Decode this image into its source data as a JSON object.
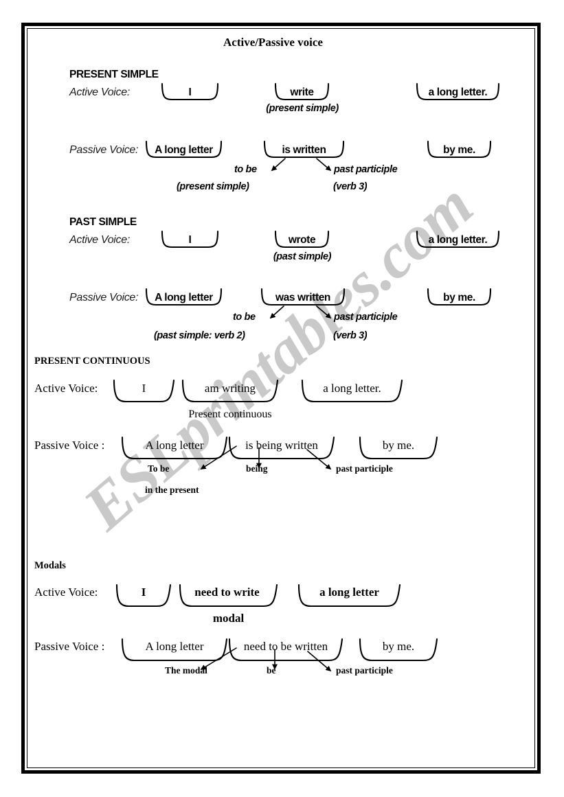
{
  "document": {
    "title": "Active/Passive voice",
    "watermark": "ESLprintables.com"
  },
  "sections": [
    {
      "id": "present-simple",
      "heading": "PRESENT SIMPLE",
      "style": "sans",
      "active": {
        "label": "Active Voice:",
        "cells": [
          "I",
          "write",
          "a long letter."
        ],
        "note": "(present simple)"
      },
      "passive": {
        "label": "Passive Voice:",
        "cells": [
          "A long letter",
          "is written",
          "by me."
        ],
        "annotations": [
          "to be",
          "past participle"
        ],
        "notes": [
          "(present simple)",
          "(verb 3)"
        ]
      }
    },
    {
      "id": "past-simple",
      "heading": "PAST SIMPLE",
      "style": "sans",
      "active": {
        "label": "Active Voice:",
        "cells": [
          "I",
          "wrote",
          "a long letter."
        ],
        "note": "(past simple)"
      },
      "passive": {
        "label": "Passive Voice:",
        "cells": [
          "A long letter",
          "was written",
          "by me."
        ],
        "annotations": [
          "to be",
          "past participle"
        ],
        "notes": [
          "(past simple: verb 2)",
          "(verb 3)"
        ]
      }
    },
    {
      "id": "present-continuous",
      "heading": "PRESENT CONTINUOUS",
      "style": "serif",
      "active": {
        "label": "Active Voice:",
        "cells": [
          "I",
          "am writing",
          "a long letter."
        ],
        "note": "Present continuous"
      },
      "passive": {
        "label": "Passive Voice :",
        "cells": [
          "A long letter",
          "is being written",
          "by me."
        ],
        "annotations": [
          "To be",
          "being",
          "past participle"
        ],
        "notes": [
          "in the present"
        ]
      }
    },
    {
      "id": "modals",
      "heading": "Modals",
      "style": "serif",
      "active": {
        "label": "Active Voice:",
        "cells": [
          "I",
          "need to write",
          "a long letter"
        ],
        "note": "modal"
      },
      "passive": {
        "label": "Passive Voice :",
        "cells": [
          "A long letter",
          "need to be written",
          "by me."
        ],
        "annotations": [
          "The modal",
          "be",
          "past participle"
        ],
        "notes": []
      }
    }
  ],
  "colors": {
    "ink": "#000000",
    "watermark": "#c9c9c9",
    "paper": "#ffffff"
  }
}
